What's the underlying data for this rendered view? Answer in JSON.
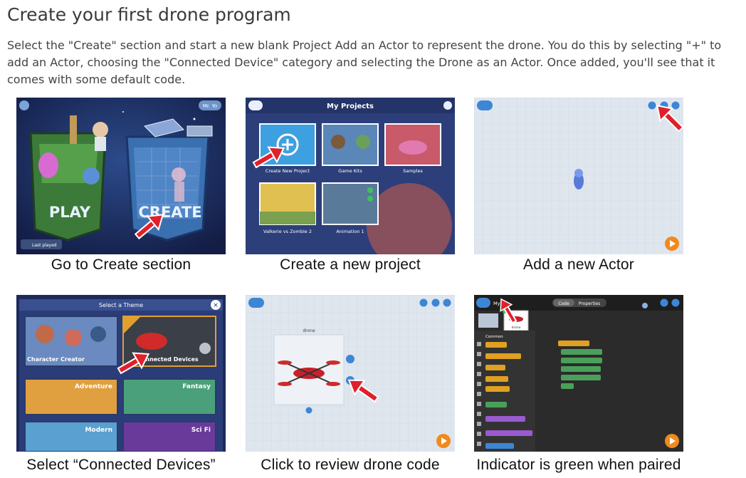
{
  "page": {
    "title": "Create your first drone program",
    "intro": "Select the \"Create\" section and start a new blank Project Add an Actor to represent the drone. You do this by selecting \"+\" to add an Actor, choosing the \"Connected Device\" category and selecting the Drone as an Actor. Once added, you'll see that it comes with some default code."
  },
  "steps": [
    {
      "caption": "Go to Create section"
    },
    {
      "caption": "Create a new project"
    },
    {
      "caption": "Add a new Actor"
    },
    {
      "caption": "Select “Connected Devices”"
    },
    {
      "caption": "Click to review drone code"
    },
    {
      "caption": "Indicator is green when paired"
    }
  ],
  "screen1": {
    "user_badge": "Mr. Yo",
    "play_label": "PLAY",
    "create_label": "CREATE",
    "last_played": "Last played"
  },
  "screen2": {
    "header": "My Projects",
    "items": [
      "Create New Project",
      "Game Kits",
      "Samples",
      "Valkerie vs Zombie 2",
      "Animation 1"
    ]
  },
  "screen4": {
    "header": "Select a Theme",
    "themes": [
      "Character Creator",
      "Connected Devices",
      "Adventure",
      "Fantasy",
      "Modern",
      "Sci Fi"
    ]
  },
  "screen5": {
    "actor_label": "drone"
  },
  "screen6": {
    "project": "My P",
    "tab_code": "Code",
    "tab_properties": "Properties",
    "category": "Common",
    "actor_label": "drone"
  },
  "colors": {
    "accent_red": "#e0202a",
    "play_orange": "#f08a1c",
    "paper_grid": "#dfe6ee",
    "editor_dark": "#2b2b2b"
  }
}
